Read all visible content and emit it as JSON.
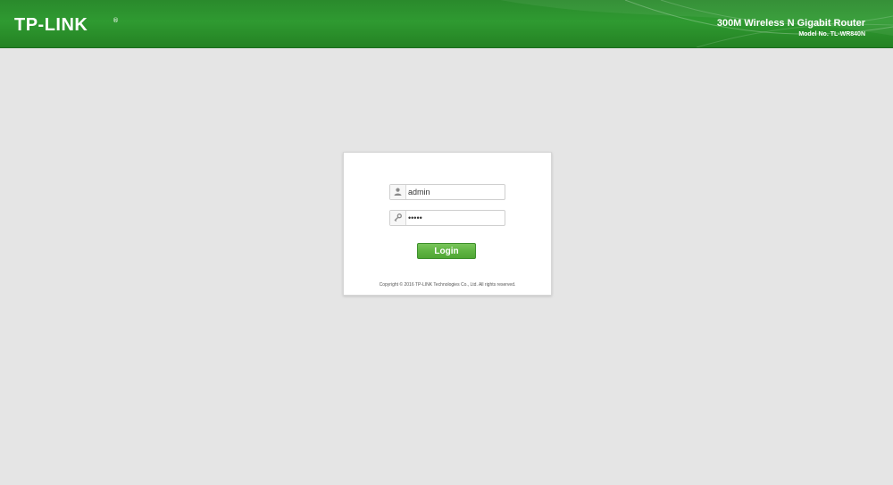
{
  "header": {
    "logo_text": "TP-LINK",
    "logo_reg": "®",
    "product_name": "300M Wireless N Gigabit Router",
    "model_no": "Model No. TL-WR840N"
  },
  "login": {
    "username_value": "admin",
    "password_value": "admin",
    "button_label": "Login",
    "copyright": "Copyright © 2016 TP-LINK Technologies Co., Ltd. All rights reserved."
  },
  "icons": {
    "user": "user-icon",
    "password": "key-icon"
  },
  "colors": {
    "header_green": "#2f9a31",
    "button_green": "#5fb442",
    "background": "#e5e5e5"
  }
}
